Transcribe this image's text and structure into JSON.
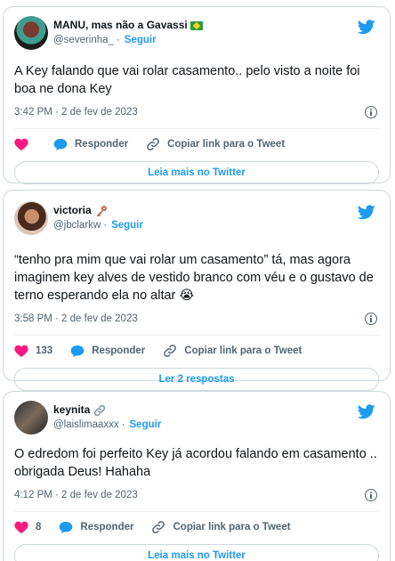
{
  "colors": {
    "accent": "#1d9bf0",
    "like": "#f91880",
    "border": "#cfd9de",
    "muted": "#536471"
  },
  "tweets": [
    {
      "name": "MANU, mas não a Gavassi",
      "badge": "brazil-flag",
      "handle": "@severinha_",
      "separator": "·",
      "follow": "Seguir",
      "text": "A Key falando que vai rolar casamento.. pelo visto a noite foi boa ne dona Key",
      "timestamp": "3:42 PM · 2 de fev de 2023",
      "like_count": "",
      "reply_label": "Responder",
      "copy_label": "Copiar link para o Tweet",
      "more_label": "Leia mais no Twitter"
    },
    {
      "name": "victoria",
      "badge": "key-emoji",
      "handle": "@jbclarkw",
      "separator": "·",
      "follow": "Seguir",
      "text": "“tenho pra mim que vai rolar um casamento” tá, mas agora imaginem key alves de vestido branco com véu  e o gustavo de terno esperando ela no altar 😭",
      "timestamp": "3:58 PM · 2 de fev de 2023",
      "like_count": "133",
      "reply_label": "Responder",
      "copy_label": "Copiar link para o Tweet",
      "more_label": "Ler 2 respostas"
    },
    {
      "name": "keynita",
      "badge": "link-emoji",
      "handle": "@laislimaaxxx",
      "separator": "·",
      "follow": "Seguir",
      "text": "O edredom foi perfeito Key já acordou falando em casamento .. obrigada Deus! Hahaha",
      "timestamp": "4:12 PM · 2 de fev de 2023",
      "like_count": "8",
      "reply_label": "Responder",
      "copy_label": "Copiar link para o Tweet",
      "more_label": "Leia mais no Twitter"
    }
  ]
}
